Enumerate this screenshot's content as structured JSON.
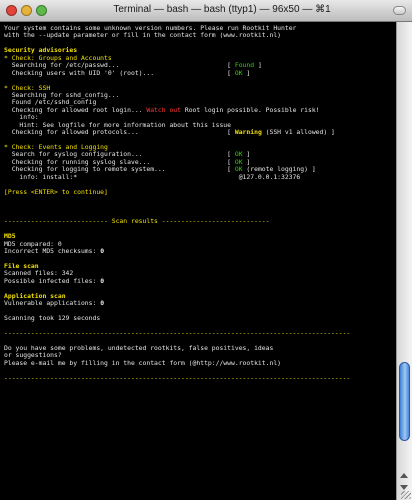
{
  "window": {
    "title": "Terminal — bash — bash (ttyp1) — 96x50 — ⌘1"
  },
  "terminal": {
    "lines": [
      [
        {
          "t": "Your system contains some unknown version numbers. Please run Rootkit Hunter",
          "c": "white"
        }
      ],
      [
        {
          "t": "with the --update parameter or fill in the contact form (www.rootkit.nl)",
          "c": "white"
        }
      ],
      [
        {
          "t": "",
          "c": "white"
        }
      ],
      [
        {
          "t": "Security advisories",
          "c": "yellow",
          "b": true
        }
      ],
      [
        {
          "t": "* Check: Groups and Accounts",
          "c": "yellow"
        }
      ],
      [
        {
          "t": "  Searching for /etc/passwd...                            [ ",
          "c": "white"
        },
        {
          "t": "Found",
          "c": "green"
        },
        {
          "t": " ]",
          "c": "white"
        }
      ],
      [
        {
          "t": "  Checking users with UID '0' (root)...                   [ ",
          "c": "white"
        },
        {
          "t": "OK",
          "c": "green"
        },
        {
          "t": " ]",
          "c": "white"
        }
      ],
      [
        {
          "t": "",
          "c": "white"
        }
      ],
      [
        {
          "t": "* Check: SSH",
          "c": "yellow"
        }
      ],
      [
        {
          "t": "  Searching for sshd_config...",
          "c": "white"
        }
      ],
      [
        {
          "t": "  Found /etc/sshd_config",
          "c": "white"
        }
      ],
      [
        {
          "t": "  Checking for allowed root login... ",
          "c": "white"
        },
        {
          "t": "Watch out",
          "c": "red"
        },
        {
          "t": " Root login possible. Possible risk!",
          "c": "white"
        }
      ],
      [
        {
          "t": "    info:",
          "c": "white"
        }
      ],
      [
        {
          "t": "    Hint: See logfile for more information about this issue",
          "c": "white"
        }
      ],
      [
        {
          "t": "  Checking for allowed protocols...                       [ ",
          "c": "white"
        },
        {
          "t": "Warning",
          "c": "yellow",
          "b": true
        },
        {
          "t": " (SSH v1 allowed) ]",
          "c": "white"
        }
      ],
      [
        {
          "t": "",
          "c": "white"
        }
      ],
      [
        {
          "t": "* Check: Events and Logging",
          "c": "yellow"
        }
      ],
      [
        {
          "t": "  Search for syslog configuration...                      [ ",
          "c": "white"
        },
        {
          "t": "OK",
          "c": "green"
        },
        {
          "t": " ]",
          "c": "white"
        }
      ],
      [
        {
          "t": "  Checking for running syslog slave...                    [ ",
          "c": "white"
        },
        {
          "t": "OK",
          "c": "green"
        },
        {
          "t": " ]",
          "c": "white"
        }
      ],
      [
        {
          "t": "  Checking for logging to remote system...                [ ",
          "c": "white"
        },
        {
          "t": "OK",
          "c": "green"
        },
        {
          "t": " (remote logging) ]",
          "c": "white"
        }
      ],
      [
        {
          "t": "    info: install:*                                          @127.0.0.1:32376",
          "c": "white"
        }
      ],
      [
        {
          "t": "",
          "c": "white"
        }
      ],
      [
        {
          "t": "[Press <ENTER> to continue]",
          "c": "yellow"
        }
      ],
      [
        {
          "t": "",
          "c": "white"
        }
      ],
      [
        {
          "t": "",
          "c": "white"
        }
      ],
      [
        {
          "t": "",
          "c": "white"
        }
      ],
      [
        {
          "t": "--------------------------- Scan results ----------------------------",
          "c": "yellow"
        }
      ],
      [
        {
          "t": "",
          "c": "white"
        }
      ],
      [
        {
          "t": "MD5",
          "c": "yellow",
          "b": true
        }
      ],
      [
        {
          "t": "MD5 compared: 0",
          "c": "white"
        }
      ],
      [
        {
          "t": "Incorrect MD5 checksums: ",
          "c": "white"
        },
        {
          "t": "0",
          "c": "white",
          "b": true
        }
      ],
      [
        {
          "t": "",
          "c": "white"
        }
      ],
      [
        {
          "t": "File scan",
          "c": "yellow",
          "b": true
        }
      ],
      [
        {
          "t": "Scanned files: 342",
          "c": "white"
        }
      ],
      [
        {
          "t": "Possible infected files: ",
          "c": "white"
        },
        {
          "t": "0",
          "c": "white",
          "b": true
        }
      ],
      [
        {
          "t": "",
          "c": "white"
        }
      ],
      [
        {
          "t": "Application scan",
          "c": "yellow",
          "b": true
        }
      ],
      [
        {
          "t": "Vulnerable applications: ",
          "c": "white"
        },
        {
          "t": "0",
          "c": "white",
          "b": true
        }
      ],
      [
        {
          "t": "",
          "c": "white"
        }
      ],
      [
        {
          "t": "Scanning took 129 seconds",
          "c": "white"
        }
      ],
      [
        {
          "t": "",
          "c": "white"
        }
      ],
      [
        {
          "t": "------------------------------------------------------------------------------------------",
          "c": "yellow"
        }
      ],
      [
        {
          "t": "",
          "c": "white"
        }
      ],
      [
        {
          "t": "Do you have some problems, undetected rootkits, false positives, ideas",
          "c": "white"
        }
      ],
      [
        {
          "t": "or suggestions?",
          "c": "white"
        }
      ],
      [
        {
          "t": "Please e-mail me by filling in the contact form (@http://www.rootkit.nl)",
          "c": "white"
        }
      ],
      [
        {
          "t": "",
          "c": "white"
        }
      ],
      [
        {
          "t": "------------------------------------------------------------------------------------------",
          "c": "yellow"
        }
      ]
    ]
  },
  "scrollbar": {
    "position_fraction": 0.93,
    "visible_fraction": 0.18
  },
  "colors": {
    "background": "#000000",
    "white": "#e6e6e6",
    "yellow": "#f2e000",
    "green": "#32d400",
    "red": "#ff3636"
  },
  "icons": [
    "close-button-icon",
    "minimize-button-icon",
    "zoom-button-icon",
    "toolbar-toggle-icon",
    "scroll-up-arrow-icon",
    "scroll-down-arrow-icon",
    "resize-grip-icon"
  ]
}
